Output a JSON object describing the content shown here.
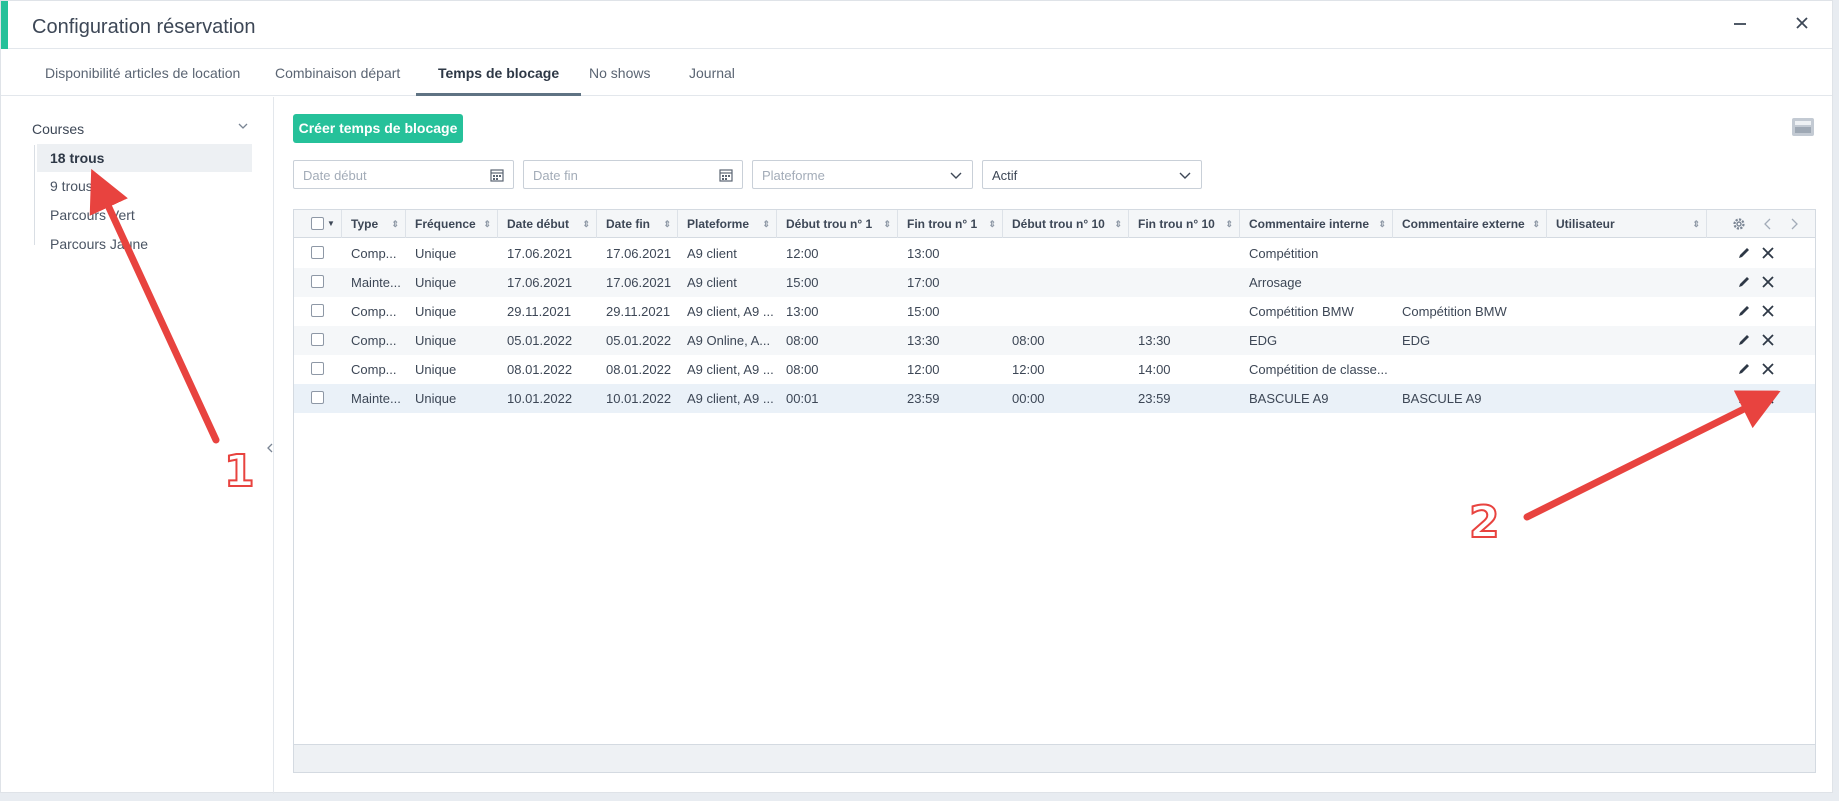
{
  "window": {
    "title": "Configuration réservation"
  },
  "tabs": [
    {
      "label": "Disponibilité articles de location"
    },
    {
      "label": "Combinaison départ"
    },
    {
      "label": "Temps de blocage"
    },
    {
      "label": "No shows"
    },
    {
      "label": "Journal"
    }
  ],
  "sidebar": {
    "header": "Courses",
    "items": [
      {
        "label": "18 trous"
      },
      {
        "label": "9 trous"
      },
      {
        "label": "Parcours Vert"
      },
      {
        "label": "Parcours Jaune"
      }
    ]
  },
  "toolbar": {
    "create_label": "Créer temps de blocage"
  },
  "filters": {
    "date_start_placeholder": "Date début",
    "date_end_placeholder": "Date fin",
    "platform_placeholder": "Plateforme",
    "status_value": "Actif"
  },
  "grid": {
    "columns": [
      "Type",
      "Fréquence",
      "Date début",
      "Date fin",
      "Plateforme",
      "Début trou n° 1",
      "Fin trou n° 1",
      "Début trou n° 10",
      "Fin trou n° 10",
      "Commentaire interne",
      "Commentaire externe",
      "Utilisateur"
    ],
    "rows": [
      {
        "type": "Comp...",
        "freq": "Unique",
        "start": "17.06.2021",
        "end": "17.06.2021",
        "platform": "A9 client",
        "s1": "12:00",
        "e1": "13:00",
        "s10": "",
        "e10": "",
        "int": "Compétition",
        "ext": "",
        "user": ""
      },
      {
        "type": "Mainte...",
        "freq": "Unique",
        "start": "17.06.2021",
        "end": "17.06.2021",
        "platform": "A9 client",
        "s1": "15:00",
        "e1": "17:00",
        "s10": "",
        "e10": "",
        "int": "Arrosage",
        "ext": "",
        "user": ""
      },
      {
        "type": "Comp...",
        "freq": "Unique",
        "start": "29.11.2021",
        "end": "29.11.2021",
        "platform": "A9 client, A9 ...",
        "s1": "13:00",
        "e1": "15:00",
        "s10": "",
        "e10": "",
        "int": "Compétition BMW",
        "ext": "Compétition BMW",
        "user": ""
      },
      {
        "type": "Comp...",
        "freq": "Unique",
        "start": "05.01.2022",
        "end": "05.01.2022",
        "platform": "A9 Online, A...",
        "s1": "08:00",
        "e1": "13:30",
        "s10": "08:00",
        "e10": "13:30",
        "int": "EDG",
        "ext": "EDG",
        "user": ""
      },
      {
        "type": "Comp...",
        "freq": "Unique",
        "start": "08.01.2022",
        "end": "08.01.2022",
        "platform": "A9 client, A9 ...",
        "s1": "08:00",
        "e1": "12:00",
        "s10": "12:00",
        "e10": "14:00",
        "int": "Compétition de classe...",
        "ext": "",
        "user": ""
      },
      {
        "type": "Mainte...",
        "freq": "Unique",
        "start": "10.01.2022",
        "end": "10.01.2022",
        "platform": "A9 client, A9 ...",
        "s1": "00:01",
        "e1": "23:59",
        "s10": "00:00",
        "e10": "23:59",
        "int": "BASCULE A9",
        "ext": "BASCULE A9",
        "user": ""
      }
    ]
  },
  "annotations": {
    "marker_1": "1",
    "marker_2": "2"
  },
  "colors": {
    "accent": "#26c19a",
    "arrow": "#e8433f"
  }
}
